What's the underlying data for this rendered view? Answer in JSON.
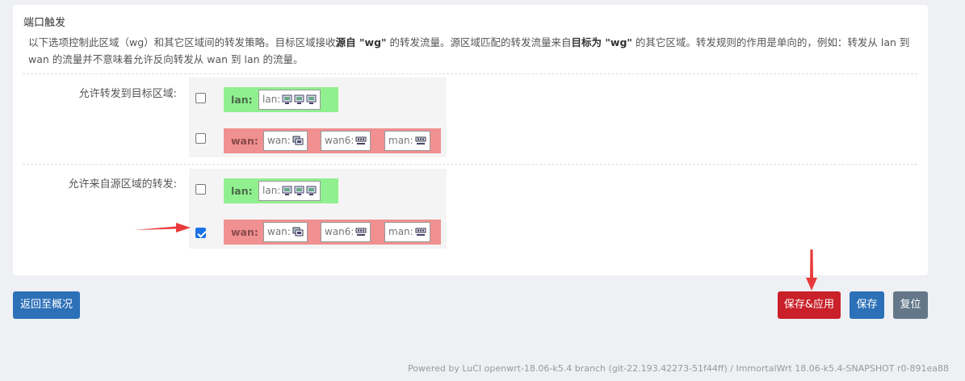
{
  "section": {
    "title": "端口触发",
    "desc_1": "以下选项控制此区域（wg）和其它区域间的转发策略。目标区域接收",
    "desc_bold_1": "源自 \"wg\"",
    "desc_2": " 的转发流量。源区域匹配的转发流量来自",
    "desc_bold_2": "目标为 \"wg\"",
    "desc_3": " 的其它区域。转发规则的作用是单向的，例如：转发从 lan 到 wan 的流量并不意味着允许反向转发从 wan 到 lan 的流量。"
  },
  "forward_dest": {
    "label": "允许转发到目标区域:",
    "zones": [
      {
        "zone": "lan:",
        "checked": false,
        "networks": [
          {
            "name": "lan:",
            "icons": [
              "ethernet-icon",
              "ethernet-icon",
              "ethernet-icon"
            ]
          }
        ]
      },
      {
        "zone": "wan:",
        "checked": false,
        "networks": [
          {
            "name": "wan:",
            "icons": [
              "bridge-icon"
            ]
          },
          {
            "name": "wan6:",
            "icons": [
              "switch-icon"
            ]
          },
          {
            "name": "man:",
            "icons": [
              "switch-icon"
            ]
          }
        ]
      }
    ]
  },
  "forward_src": {
    "label": "允许来自源区域的转发:",
    "zones": [
      {
        "zone": "lan:",
        "checked": false,
        "networks": [
          {
            "name": "lan:",
            "icons": [
              "ethernet-icon",
              "ethernet-icon",
              "ethernet-icon"
            ]
          }
        ]
      },
      {
        "zone": "wan:",
        "checked": true,
        "networks": [
          {
            "name": "wan:",
            "icons": [
              "bridge-icon"
            ]
          },
          {
            "name": "wan6:",
            "icons": [
              "switch-icon"
            ]
          },
          {
            "name": "man:",
            "icons": [
              "switch-icon"
            ]
          }
        ]
      }
    ]
  },
  "buttons": {
    "back": "返回至概况",
    "save_apply": "保存&应用",
    "save": "保存",
    "reset": "复位"
  },
  "footer": "Powered by LuCI openwrt-18.06-k5.4 branch (git-22.193.42273-51f44ff) / ImmortalWrt 18.06-k5.4-SNAPSHOT r0-891ea88",
  "colors": {
    "lan_zone": "#90f090",
    "wan_zone": "#f09090",
    "primary": "#2c70b8",
    "danger": "#c9202a",
    "annotation_arrow": "#e83a3a"
  }
}
